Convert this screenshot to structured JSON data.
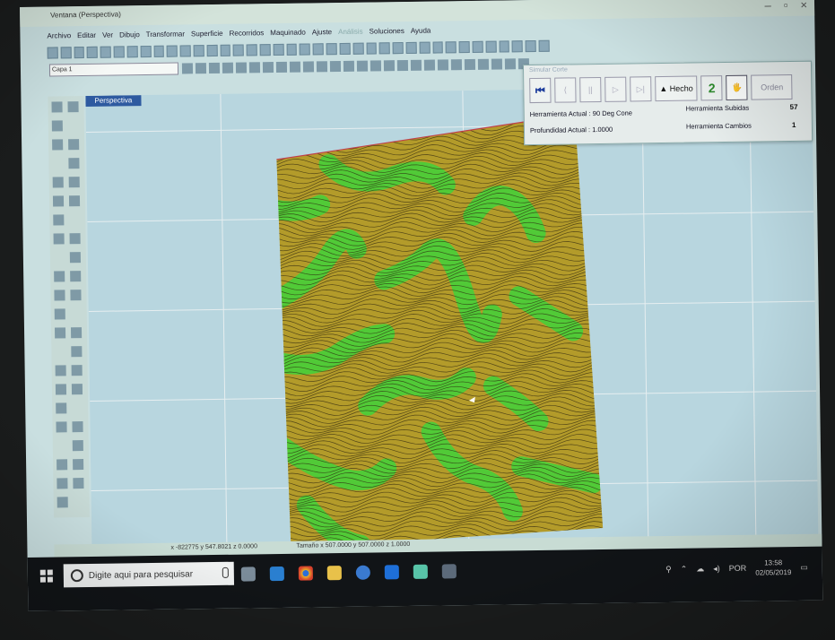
{
  "window": {
    "title": "Ventana (Perspectiva)",
    "controls": [
      "–",
      "▫",
      "×"
    ]
  },
  "menu": [
    "Archivo",
    "Editar",
    "Ver",
    "Dibujo",
    "Transformar",
    "Superficie",
    "Recorridos",
    "Maquinado",
    "Ajuste",
    "Análisis",
    "Soluciones",
    "Ayuda"
  ],
  "layer": "Capa 1",
  "viewport_tab": "Perspectiva",
  "panel": {
    "title": "Simular Corte",
    "buttons": {
      "rewind": "⏮",
      "step_back": "⟨",
      "pause": "||",
      "play": "▷",
      "step": "▷|",
      "done": "▲ Hecho",
      "tool_green": "2",
      "tool_select": "🖐",
      "ordenar": "Orden"
    },
    "herramienta_actual_label": "Herramienta Actual : 90 Deg Cone",
    "profundidad_label": "Profundidad Actual : 1.0000",
    "subidas_label": "Herramienta Subidas",
    "subidas_value": "57",
    "cambios_label": "Herramienta Cambios",
    "cambios_value": "1"
  },
  "status": {
    "coords": "x -822775 y 547.8021 z 0.0000",
    "size": "Tamaño x 507.0000 y 507.0000 z 1.0000"
  },
  "taskbar": {
    "search_placeholder": "Digite aqui para pesquisar",
    "lang": "POR",
    "time": "13:58",
    "date": "02/05/2019"
  },
  "colors": {
    "terrain_base": "#b39b2a",
    "terrain_green": "#3fd23a",
    "panel_bg": "#e6eceb",
    "viewport_tab": "#2e5aa0"
  }
}
